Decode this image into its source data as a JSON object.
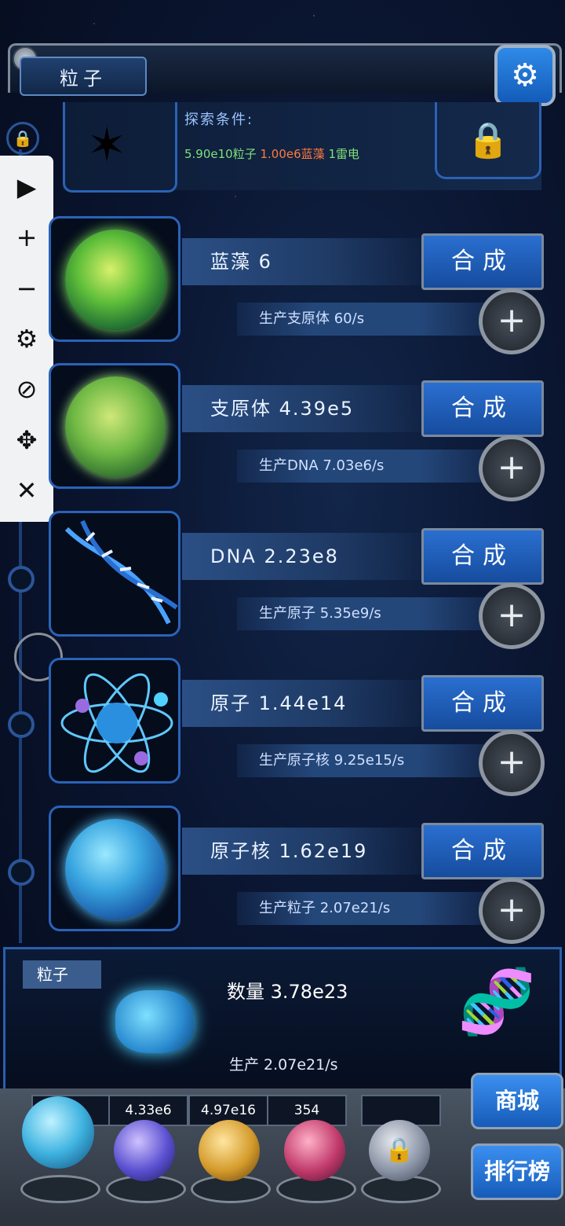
{
  "header": {
    "title": "粒子"
  },
  "explore": {
    "label": "探索条件:",
    "requirements": [
      {
        "text": "5.90e10粒子",
        "color": "#7fe07a"
      },
      {
        "text": "1.00e6蓝藻",
        "color": "#ff7a3d"
      },
      {
        "text": "1雷电",
        "color": "#7fe07a"
      }
    ]
  },
  "toolbar": {
    "icons": [
      "play-icon",
      "plus-icon",
      "minus-icon",
      "gear-icon",
      "eye-off-icon",
      "move-icon",
      "close-icon"
    ]
  },
  "rows": [
    {
      "name": "蓝藻 6",
      "synth": "合成",
      "production": "生产支原体 60/s"
    },
    {
      "name": "支原体 4.39e5",
      "synth": "合成",
      "production": "生产DNA 7.03e6/s"
    },
    {
      "name": "DNA 2.23e8",
      "synth": "合成",
      "production": "生产原子 5.35e9/s"
    },
    {
      "name": "原子 1.44e14",
      "synth": "合成",
      "production": "生产原子核 9.25e15/s"
    },
    {
      "name": "原子核 1.62e19",
      "synth": "合成",
      "production": "生产粒子 2.07e21/s"
    }
  ],
  "bottom": {
    "label": "粒子",
    "count": "数量 3.78e23",
    "production": "生产 2.07e21/s"
  },
  "dock": {
    "stats": [
      "4.33e6",
      "4.97e16",
      "354",
      ""
    ],
    "shop": "商城",
    "ranking": "排行榜"
  }
}
